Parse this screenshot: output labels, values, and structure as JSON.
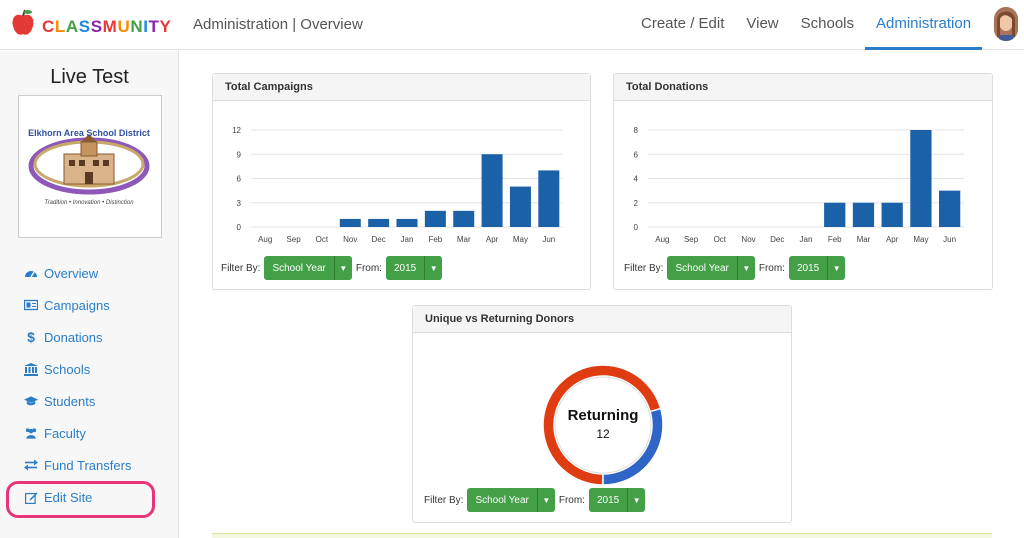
{
  "brand": {
    "name": "CLASSMUNITY",
    "colors": [
      "#e53935",
      "#fb8c00",
      "#43a047",
      "#1e88e5",
      "#8e24aa"
    ]
  },
  "header": {
    "title": "Administration | Overview",
    "nav": [
      {
        "label": "Create / Edit",
        "active": false
      },
      {
        "label": "View",
        "active": false
      },
      {
        "label": "Schools",
        "active": false
      },
      {
        "label": "Administration",
        "active": true
      }
    ]
  },
  "sidebar": {
    "site_name": "Live Test",
    "logo_text": {
      "arc": "Elkhorn Area School District",
      "tagline": "Tradition • Innovation • Distinction"
    },
    "items": [
      {
        "label": "Overview",
        "icon": "dashboard-icon"
      },
      {
        "label": "Campaigns",
        "icon": "campaigns-icon"
      },
      {
        "label": "Donations",
        "icon": "dollar-icon"
      },
      {
        "label": "Schools",
        "icon": "bank-icon"
      },
      {
        "label": "Students",
        "icon": "graduation-cap-icon"
      },
      {
        "label": "Faculty",
        "icon": "users-icon"
      },
      {
        "label": "Fund Transfers",
        "icon": "exchange-icon"
      },
      {
        "label": "Edit Site",
        "icon": "edit-icon",
        "highlighted": true
      }
    ]
  },
  "filters": {
    "filter_by": "Filter By:",
    "from": "From:",
    "period": "School Year",
    "year": "2015"
  },
  "colors": {
    "bar": "#1a61a8",
    "accent": "#2a7ec9",
    "button": "#43a047",
    "highlight": "#e8357a",
    "donut_returning": "#e03c12",
    "donut_unique": "#3065c8"
  },
  "chart_data": [
    {
      "type": "bar",
      "title": "Total Campaigns",
      "categories": [
        "Aug",
        "Sep",
        "Oct",
        "Nov",
        "Dec",
        "Jan",
        "Feb",
        "Mar",
        "Apr",
        "May",
        "Jun"
      ],
      "values": [
        0,
        0,
        0,
        1,
        1,
        1,
        2,
        2,
        9,
        5,
        7
      ],
      "yticks": [
        0,
        3,
        6,
        9,
        12
      ],
      "ylim": [
        0,
        12
      ]
    },
    {
      "type": "bar",
      "title": "Total Donations",
      "categories": [
        "Aug",
        "Sep",
        "Oct",
        "Nov",
        "Dec",
        "Jan",
        "Feb",
        "Mar",
        "Apr",
        "May",
        "Jun"
      ],
      "values": [
        0,
        0,
        0,
        0,
        0,
        0,
        2,
        2,
        2,
        8,
        3
      ],
      "yticks": [
        0,
        2,
        4,
        6,
        8
      ],
      "ylim": [
        0,
        8
      ]
    },
    {
      "type": "pie",
      "title": "Unique vs Returning Donors",
      "center_label": "Returning",
      "center_value": "12",
      "slices": [
        {
          "name": "Returning",
          "value": 12
        },
        {
          "name": "Unique",
          "value": 5
        }
      ]
    }
  ]
}
